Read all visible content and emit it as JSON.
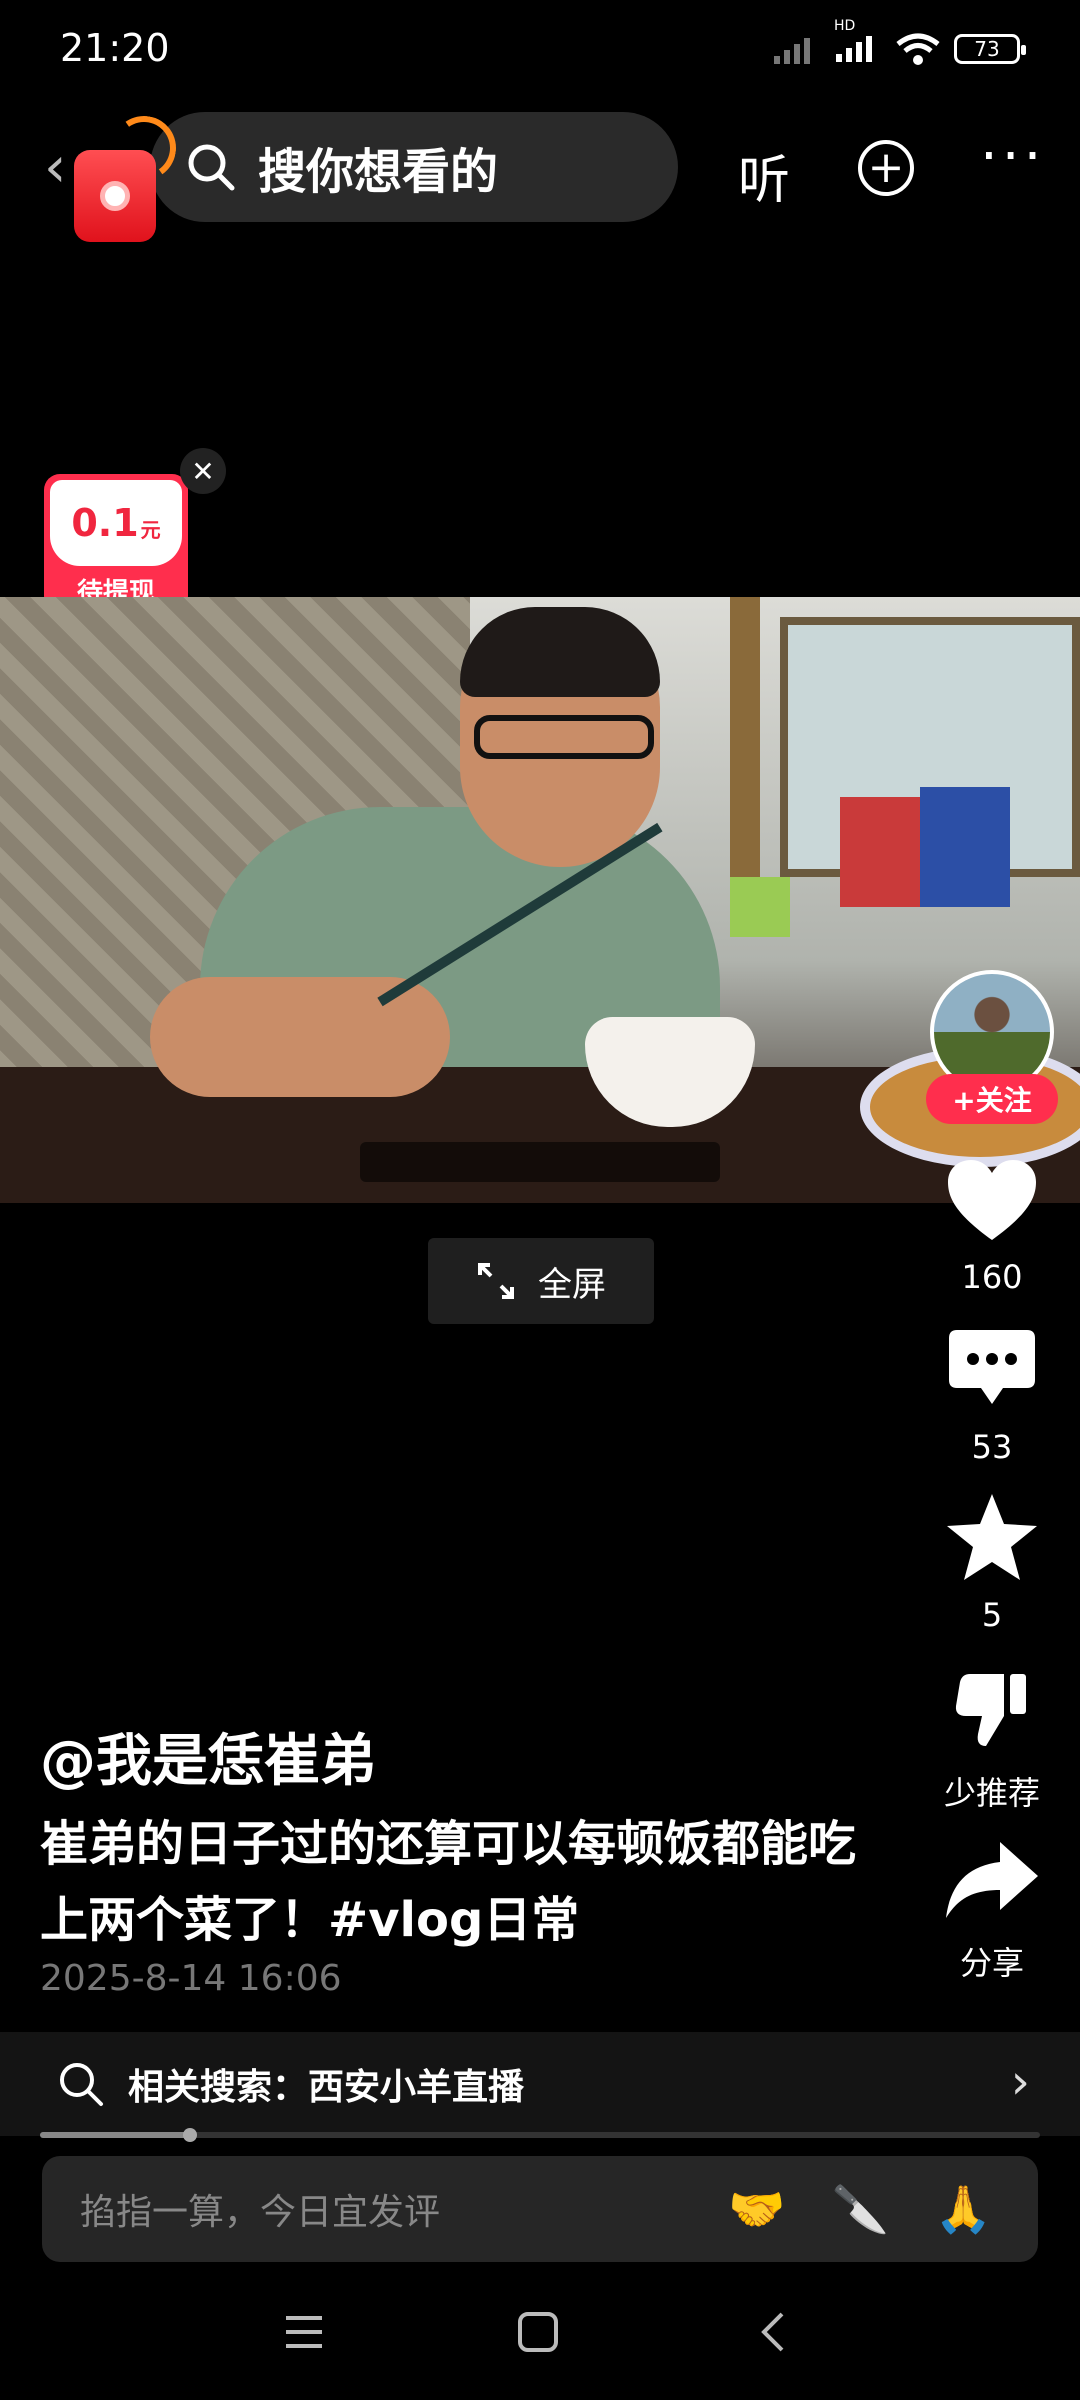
{
  "status_bar": {
    "time": "21:20",
    "battery": "73",
    "network": "HD"
  },
  "top_bar": {
    "search_placeholder": "搜你想看的",
    "listen_label": "听"
  },
  "cash_widget": {
    "amount": "0.1",
    "unit": "元",
    "label": "待提现"
  },
  "video": {
    "fullscreen_label": "全屏"
  },
  "actions": {
    "follow_label": "+关注",
    "likes": "160",
    "comments": "53",
    "favorites": "5",
    "dislike_label": "少推荐",
    "share_label": "分享"
  },
  "post": {
    "author": "@我是恁崔弟",
    "caption": "崔弟的日子过的还算可以每顿饭都能吃上两个菜了！#vlog日常",
    "timestamp": "2025-8-14 16:06"
  },
  "related_search": {
    "label": "相关搜索：西安小羊直播"
  },
  "playback": {
    "progress_fraction": 0.15
  },
  "comment_input": {
    "placeholder": "掐指一算，今日宜发评",
    "emojis": [
      "🤝",
      "🔪",
      "🙏"
    ]
  },
  "colors": {
    "accent": "#ff2e4d",
    "background": "#000000"
  },
  "icons": [
    "back-icon",
    "search-icon",
    "add-circle-icon",
    "more-icon",
    "close-icon",
    "expand-icon",
    "heart-icon",
    "comment-icon",
    "star-icon",
    "thumbs-down-icon",
    "share-icon",
    "chevron-right-icon",
    "menu-icon",
    "home-icon",
    "nav-back-icon"
  ]
}
